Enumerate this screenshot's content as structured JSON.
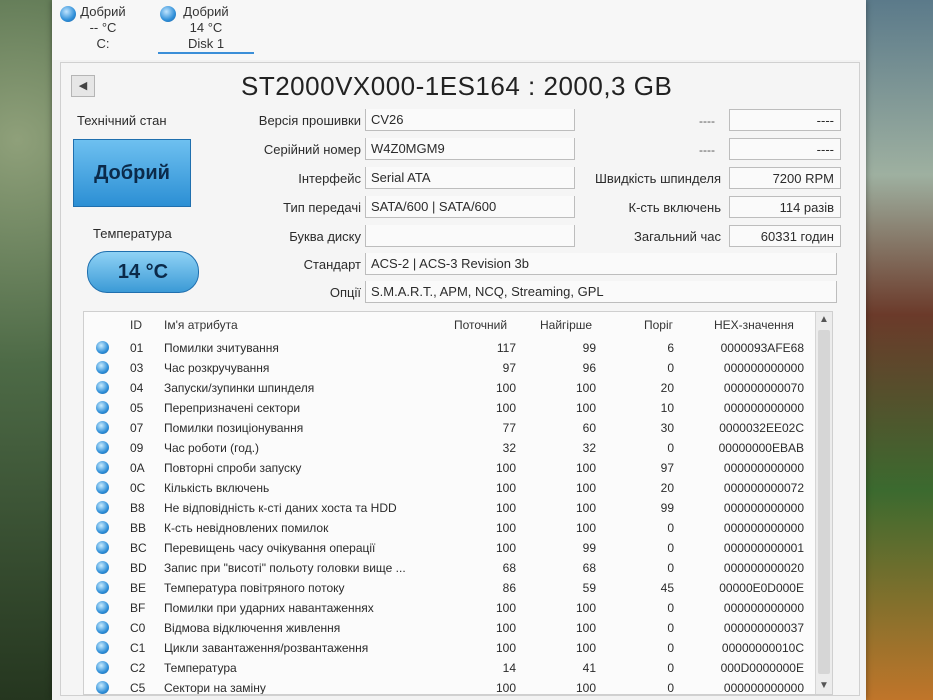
{
  "disks": [
    {
      "status": "Добрий",
      "temp": "-- °C",
      "label": "C:"
    },
    {
      "status": "Добрий",
      "temp": "14 °C",
      "label": "Disk 1"
    }
  ],
  "drive": {
    "title": "ST2000VX000-1ES164 : 2000,3 GB",
    "health_label": "Технічний стан",
    "health_value": "Добрий",
    "temp_label": "Температура",
    "temp_value": "14 °C"
  },
  "fields": {
    "firmware_label": "Версія прошивки",
    "firmware": "CV26",
    "serial_label": "Серійний номер",
    "serial": "W4Z0MGM9",
    "interface_label": "Інтерфейс",
    "interface": "Serial ATA",
    "transfer_label": "Тип передачі",
    "transfer": "SATA/600 | SATA/600",
    "letter_label": "Буква диску",
    "letter": "",
    "standard_label": "Стандарт",
    "standard": "ACS-2 | ACS-3 Revision 3b",
    "features_label": "Опції",
    "features": "S.M.A.R.T., APM, NCQ, Streaming, GPL",
    "dash": "----",
    "rpm_label": "Швидкість шпинделя",
    "rpm": "7200 RPM",
    "power_count_label": "К-сть включень",
    "power_count": "114 разів",
    "power_hours_label": "Загальний час",
    "power_hours": "60331 годин"
  },
  "table": {
    "headers": {
      "id": "ID",
      "name": "Ім'я атрибута",
      "current": "Поточний",
      "worst": "Найгірше",
      "threshold": "Поріг",
      "raw": "HEX-значення"
    },
    "rows": [
      {
        "id": "01",
        "name": "Помилки зчитування",
        "cur": "117",
        "worst": "99",
        "thr": "6",
        "raw": "0000093AFE68"
      },
      {
        "id": "03",
        "name": "Час розкручування",
        "cur": "97",
        "worst": "96",
        "thr": "0",
        "raw": "000000000000"
      },
      {
        "id": "04",
        "name": "Запуски/зупинки шпинделя",
        "cur": "100",
        "worst": "100",
        "thr": "20",
        "raw": "000000000070"
      },
      {
        "id": "05",
        "name": "Перепризначені сектори",
        "cur": "100",
        "worst": "100",
        "thr": "10",
        "raw": "000000000000"
      },
      {
        "id": "07",
        "name": "Помилки позиціонування",
        "cur": "77",
        "worst": "60",
        "thr": "30",
        "raw": "0000032EE02C"
      },
      {
        "id": "09",
        "name": "Час роботи (год.)",
        "cur": "32",
        "worst": "32",
        "thr": "0",
        "raw": "00000000EBAB"
      },
      {
        "id": "0A",
        "name": "Повторні спроби запуску",
        "cur": "100",
        "worst": "100",
        "thr": "97",
        "raw": "000000000000"
      },
      {
        "id": "0C",
        "name": "Кількість включень",
        "cur": "100",
        "worst": "100",
        "thr": "20",
        "raw": "000000000072"
      },
      {
        "id": "B8",
        "name": "Не відповідність к-сті даних хоста та HDD",
        "cur": "100",
        "worst": "100",
        "thr": "99",
        "raw": "000000000000"
      },
      {
        "id": "BB",
        "name": "К-сть невідновлених помилок",
        "cur": "100",
        "worst": "100",
        "thr": "0",
        "raw": "000000000000"
      },
      {
        "id": "BC",
        "name": "Перевищень часу очікування операції",
        "cur": "100",
        "worst": "99",
        "thr": "0",
        "raw": "000000000001"
      },
      {
        "id": "BD",
        "name": "Запис при \"висоті\" польоту головки вище ...",
        "cur": "68",
        "worst": "68",
        "thr": "0",
        "raw": "000000000020"
      },
      {
        "id": "BE",
        "name": "Температура повітряного потоку",
        "cur": "86",
        "worst": "59",
        "thr": "45",
        "raw": "00000E0D000E"
      },
      {
        "id": "BF",
        "name": "Помилки при ударних навантаженнях",
        "cur": "100",
        "worst": "100",
        "thr": "0",
        "raw": "000000000000"
      },
      {
        "id": "C0",
        "name": "Відмова відключення живлення",
        "cur": "100",
        "worst": "100",
        "thr": "0",
        "raw": "000000000037"
      },
      {
        "id": "C1",
        "name": "Цикли завантаження/розвантаження",
        "cur": "100",
        "worst": "100",
        "thr": "0",
        "raw": "00000000010C"
      },
      {
        "id": "C2",
        "name": "Температура",
        "cur": "14",
        "worst": "41",
        "thr": "0",
        "raw": "000D0000000E"
      },
      {
        "id": "C5",
        "name": "Сектори на заміну",
        "cur": "100",
        "worst": "100",
        "thr": "0",
        "raw": "000000000000"
      }
    ]
  },
  "colors": {
    "accent": "#2f8fd8",
    "health_good": "#3b9ad6"
  }
}
